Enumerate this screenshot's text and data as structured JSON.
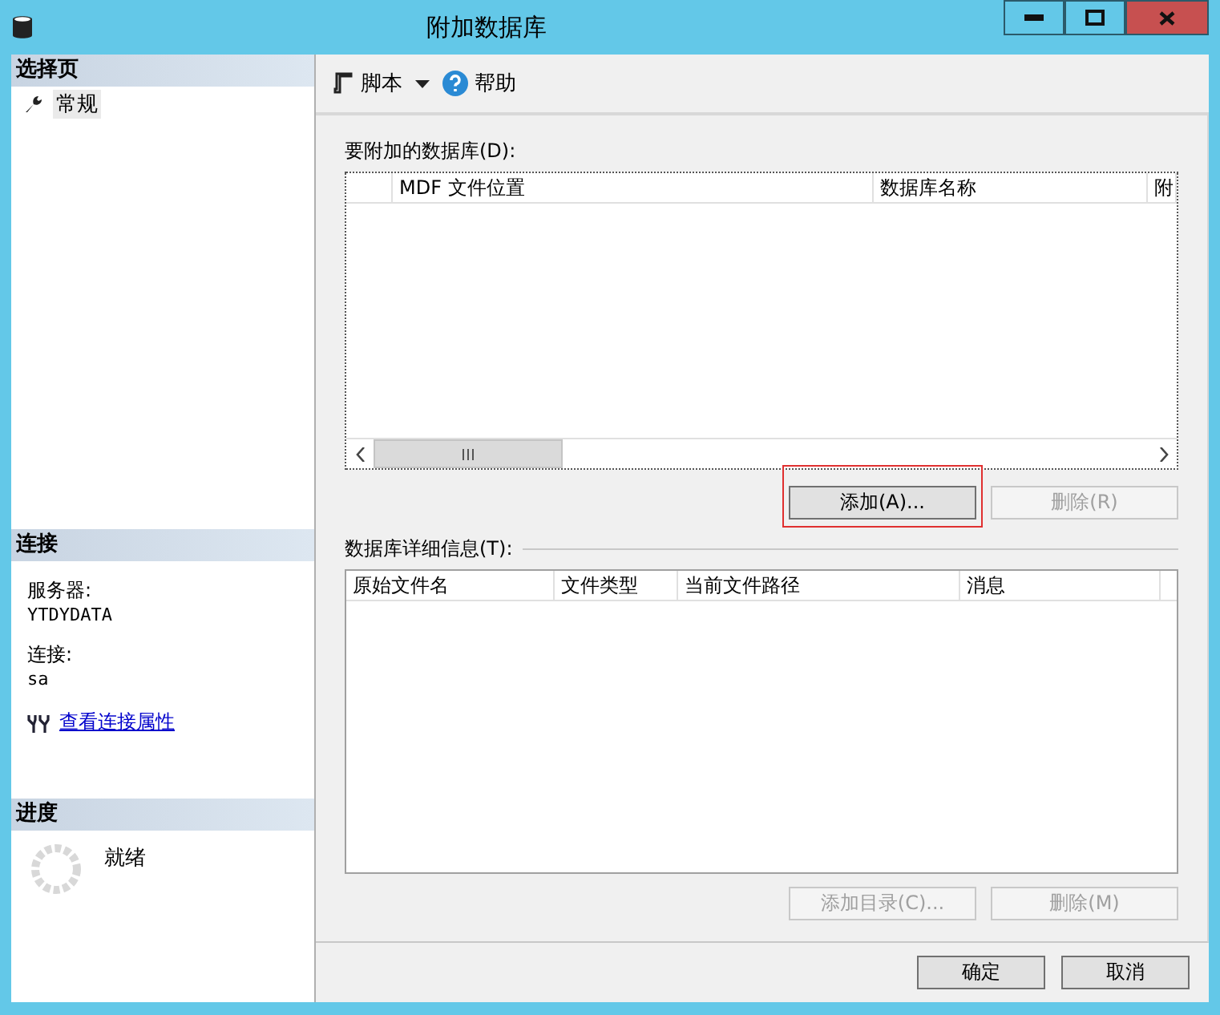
{
  "window": {
    "title": "附加数据库"
  },
  "sidebar": {
    "select_page": {
      "header": "选择页",
      "items": [
        {
          "label": "常规",
          "selected": true
        }
      ]
    },
    "connection": {
      "header": "连接",
      "server_label": "服务器:",
      "server": "YTDYDATA",
      "connection_label": "连接:",
      "connection": "sa",
      "link": "查看连接属性"
    },
    "progress": {
      "header": "进度",
      "status": "就绪"
    }
  },
  "toolbar": [
    {
      "kind": "script",
      "label": "脚本"
    },
    {
      "kind": "help",
      "label": "帮助"
    }
  ],
  "attach": {
    "label": "要附加的数据库(D):",
    "columns": [
      "MDF 文件位置",
      "数据库名称",
      "附"
    ],
    "buttons": [
      {
        "label": "添加(A)...",
        "disabled": false,
        "highlighted": true
      },
      {
        "label": "删除(R)",
        "disabled": true,
        "highlighted": false
      }
    ]
  },
  "details": {
    "label": "数据库详细信息(T):",
    "columns": [
      "原始文件名",
      "文件类型",
      "当前文件路径",
      "消息"
    ],
    "buttons": [
      {
        "label": "添加目录(C)...",
        "disabled": true,
        "highlighted": false
      },
      {
        "label": "删除(M)",
        "disabled": true,
        "highlighted": false
      }
    ]
  },
  "footer": {
    "buttons": [
      {
        "label": "确定",
        "disabled": false,
        "highlighted": false
      },
      {
        "label": "取消",
        "disabled": false,
        "highlighted": false
      }
    ]
  }
}
